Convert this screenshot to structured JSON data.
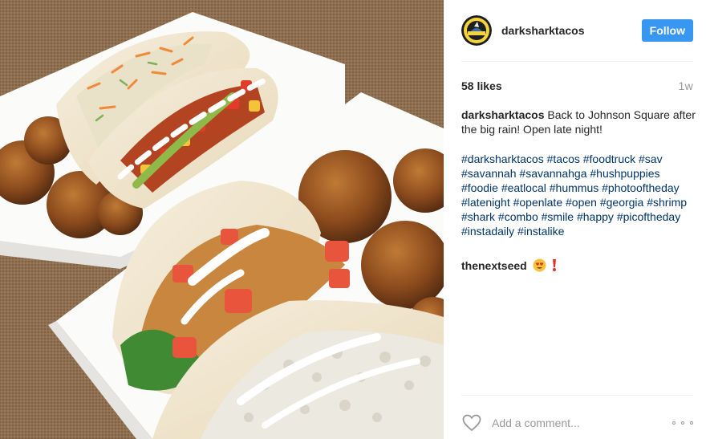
{
  "post": {
    "username": "darksharktacos",
    "follow_label": "Follow",
    "avatar_text": "DARK SHARK",
    "likes": "58 likes",
    "age": "1w",
    "caption": {
      "author": "darksharktacos",
      "text": "Back to Johnson Square after the big rain! Open late night!"
    },
    "hashtags": [
      "#darksharktacos",
      "#tacos",
      "#foodtruck",
      "#sav",
      "#savannah",
      "#savannahga",
      "#hushpuppies",
      "#foodie",
      "#eatlocal",
      "#hummus",
      "#photooftheday",
      "#latenight",
      "#openlate",
      "#open",
      "#georgia",
      "#shrimp",
      "#shark",
      "#combo",
      "#smile",
      "#happy",
      "#picoftheday",
      "#instadaily",
      "#instalike"
    ],
    "comment": {
      "author": "thenextseed",
      "emoji": "heart-eyes-emoji",
      "mark": "exclamation-icon"
    },
    "comment_placeholder": "Add a comment...",
    "icons": {
      "like": "heart-icon",
      "more": "more-options-icon"
    }
  },
  "colors": {
    "follow_button": "#3897f0",
    "hashtag": "#003569",
    "muted": "#999999",
    "text": "#262626"
  }
}
